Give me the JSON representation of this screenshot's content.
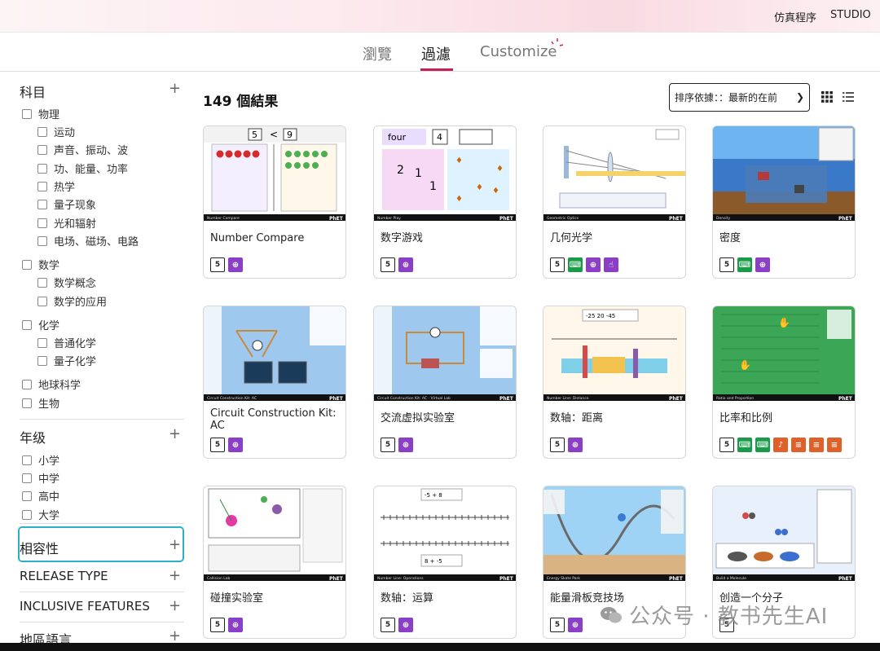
{
  "header": {
    "sims_link": "仿真程序",
    "studio_link": "STUDIO"
  },
  "tabs": [
    {
      "label": "瀏覽",
      "active": false
    },
    {
      "label": "過濾",
      "active": true
    },
    {
      "label": "Customize",
      "active": false
    }
  ],
  "accent_color": "#c4205a",
  "focus_color": "#2bb0c7",
  "sidebar": {
    "subject": {
      "title": "科目",
      "items": [
        {
          "label": "物理",
          "level": 0
        },
        {
          "label": "运动",
          "level": 1
        },
        {
          "label": "声音、振动、波",
          "level": 1
        },
        {
          "label": "功、能量、功率",
          "level": 1
        },
        {
          "label": "热学",
          "level": 1
        },
        {
          "label": "量子现象",
          "level": 1
        },
        {
          "label": "光和辐射",
          "level": 1
        },
        {
          "label": "电场、磁场、电路",
          "level": 1
        },
        {
          "label": "数学",
          "level": 0
        },
        {
          "label": "数学概念",
          "level": 1
        },
        {
          "label": "数学的应用",
          "level": 1
        },
        {
          "label": "化学",
          "level": 0
        },
        {
          "label": "普通化学",
          "level": 1
        },
        {
          "label": "量子化学",
          "level": 1
        },
        {
          "label": "地球科学",
          "level": 0
        },
        {
          "label": "生物",
          "level": 0
        }
      ]
    },
    "grade": {
      "title": "年级",
      "items": [
        {
          "label": "小学"
        },
        {
          "label": "中学"
        },
        {
          "label": "高中"
        },
        {
          "label": "大学"
        }
      ]
    },
    "collapsed_sections": [
      "相容性",
      "RELEASE TYPE",
      "INCLUSIVE FEATURES",
      "地區語言"
    ]
  },
  "results": {
    "count_label": "149 個結果",
    "sort_label": "排序依據：：最新的在前",
    "view_icons": [
      "grid-view-icon",
      "list-view-icon"
    ]
  },
  "cards": [
    {
      "title": "Number Compare",
      "thumb": "compare",
      "footer": "Number Compare",
      "icons": [
        "html5",
        "zoom"
      ]
    },
    {
      "title": "数字游戏",
      "thumb": "play",
      "footer": "Number Play",
      "icons": [
        "html5",
        "zoom"
      ]
    },
    {
      "title": "几何光学",
      "thumb": "optics",
      "footer": "Geometric Optics",
      "icons": [
        "html5",
        "kbd",
        "zoom",
        "touch"
      ]
    },
    {
      "title": "密度",
      "thumb": "density",
      "footer": "Density",
      "icons": [
        "html5",
        "kbd",
        "zoom"
      ]
    },
    {
      "title": "Circuit Construction Kit: AC",
      "thumb": "circuit",
      "footer": "Circuit Construction Kit: AC",
      "icons": [
        "html5",
        "zoom"
      ]
    },
    {
      "title": "交流虚拟实验室",
      "thumb": "circuit2",
      "footer": "Circuit Construction Kit: AC - Virtual Lab",
      "icons": [
        "html5",
        "zoom"
      ]
    },
    {
      "title": "数轴：距离",
      "thumb": "distance",
      "footer": "Number Line: Distance",
      "icons": [
        "html5",
        "zoom"
      ]
    },
    {
      "title": "比率和比例",
      "thumb": "ratio",
      "footer": "Ratio and Proportion",
      "icons": [
        "html5",
        "kbd",
        "kbd",
        "snd",
        "sh",
        "sh",
        "sh"
      ]
    },
    {
      "title": "碰撞实验室",
      "thumb": "collision",
      "footer": "Collision Lab",
      "icons": [
        "html5",
        "zoom"
      ]
    },
    {
      "title": "数轴：运算",
      "thumb": "operations",
      "footer": "Number Line: Operations",
      "icons": [
        "html5",
        "zoom"
      ]
    },
    {
      "title": "能量滑板竞技场",
      "thumb": "skate",
      "footer": "Energy Skate Park",
      "icons": [
        "html5",
        "zoom"
      ]
    },
    {
      "title": "创造一个分子",
      "thumb": "molecule",
      "footer": "Build a Molecule",
      "icons": [
        "html5"
      ]
    }
  ],
  "thumb_texts": {
    "compare_left": "5",
    "compare_op": "<",
    "compare_right": "9",
    "play_word": "four",
    "play_num": "4",
    "distance_a": "-25",
    "distance_b": "20",
    "distance_c": "-45",
    "ops_a": "-5 + 8",
    "ops_b": "8 + -5",
    "phet_logo": "PhET"
  },
  "watermark": "公众号 · 教书先生AI"
}
